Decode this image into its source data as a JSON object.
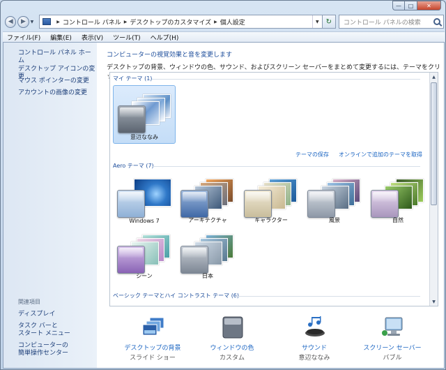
{
  "window": {
    "minimize_glyph": "—",
    "maximize_glyph": "□",
    "close_glyph": "✕"
  },
  "address": {
    "crumbs": [
      "コントロール パネル",
      "デスクトップのカスタマイズ",
      "個人設定"
    ],
    "search_placeholder": "コントロール パネルの検索",
    "refresh_glyph": "↻",
    "back_glyph": "◀",
    "forward_glyph": "▶"
  },
  "menu": [
    "ファイル(F)",
    "編集(E)",
    "表示(V)",
    "ツール(T)",
    "ヘルプ(H)"
  ],
  "sidebar": {
    "home": "コントロール パネル ホーム",
    "links": [
      "デスクトップ アイコンの変更",
      "マウス ポインターの変更",
      "アカウントの画像の変更"
    ],
    "see_also_header": "関連項目",
    "see_also": [
      "ディスプレイ",
      "タスク バーと\nスタート メニュー",
      "コンピューターの\n簡単操作センター"
    ]
  },
  "main": {
    "title": "コンピューターの視覚効果と音を変更します",
    "description": "デスクトップの背景、ウィンドウの色、サウンド、およびスクリーン セーバーをまとめて変更するには、テーマをクリックします。",
    "my_themes_label": "マイ テーマ (1)",
    "my_theme_name": "意辺ななみ",
    "save_theme": "テーマの保存",
    "get_more_online": "オンラインで追加のテーマを取得",
    "aero_label": "Aero テーマ (7)",
    "aero_themes": [
      "Windows 7",
      "アーキテクチャ",
      "キャラクター",
      "風景",
      "自然",
      "シーン",
      "日本"
    ],
    "basic_label": "ベーシック テーマとハイ コントラスト テーマ (6)"
  },
  "bottom": [
    {
      "title": "デスクトップの背景",
      "sub": "スライド ショー"
    },
    {
      "title": "ウィンドウの色",
      "sub": "カスタム"
    },
    {
      "title": "サウンド",
      "sub": "意辺ななみ"
    },
    {
      "title": "スクリーン セーバー",
      "sub": "バブル"
    }
  ],
  "colors": {
    "link": "#1a64c2",
    "heading": "#1a4b9a",
    "selected_tile": "#c4ddf7"
  }
}
